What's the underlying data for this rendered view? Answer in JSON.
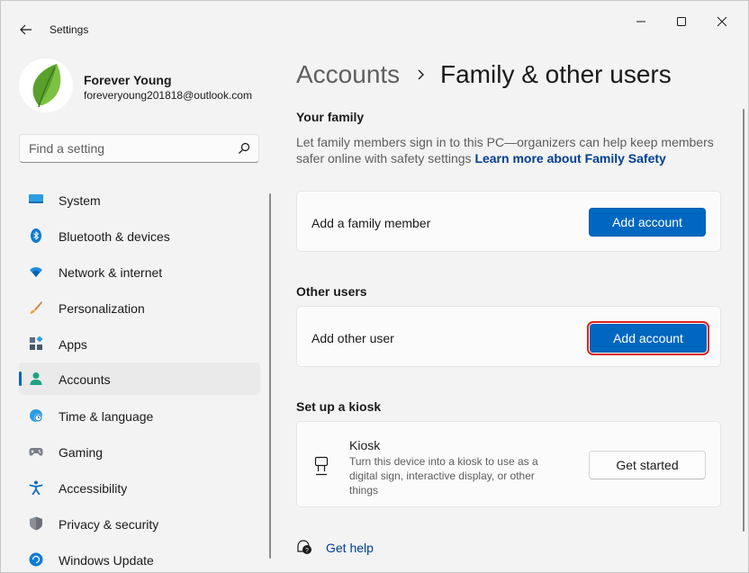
{
  "window": {
    "app_title": "Settings"
  },
  "profile": {
    "name": "Forever Young",
    "email": "foreveryoung201818@outlook.com"
  },
  "search": {
    "placeholder": "Find a setting"
  },
  "nav": {
    "items": [
      {
        "label": "System",
        "icon": "monitor-icon"
      },
      {
        "label": "Bluetooth & devices",
        "icon": "bluetooth-icon"
      },
      {
        "label": "Network & internet",
        "icon": "wifi-icon"
      },
      {
        "label": "Personalization",
        "icon": "brush-icon"
      },
      {
        "label": "Apps",
        "icon": "apps-icon"
      },
      {
        "label": "Accounts",
        "icon": "person-icon",
        "active": true
      },
      {
        "label": "Time & language",
        "icon": "globe-clock-icon"
      },
      {
        "label": "Gaming",
        "icon": "gamepad-icon"
      },
      {
        "label": "Accessibility",
        "icon": "accessibility-icon"
      },
      {
        "label": "Privacy & security",
        "icon": "shield-icon"
      },
      {
        "label": "Windows Update",
        "icon": "update-icon"
      }
    ]
  },
  "breadcrumb": {
    "parent": "Accounts",
    "current": "Family & other users"
  },
  "family": {
    "title": "Your family",
    "description": "Let family members sign in to this PC—organizers can help keep members safer online with safety settings",
    "learn_more": "Learn more about Family Safety",
    "card_label": "Add a family member",
    "button": "Add account"
  },
  "other_users": {
    "title": "Other users",
    "card_label": "Add other user",
    "button": "Add account"
  },
  "kiosk": {
    "title": "Set up a kiosk",
    "card_title": "Kiosk",
    "card_description": "Turn this device into a kiosk to use as a digital sign, interactive display, or other things",
    "button": "Get started"
  },
  "help": {
    "label": "Get help"
  },
  "colors": {
    "accent": "#0067c0",
    "highlight": "#e0201c",
    "link": "#003e92"
  }
}
